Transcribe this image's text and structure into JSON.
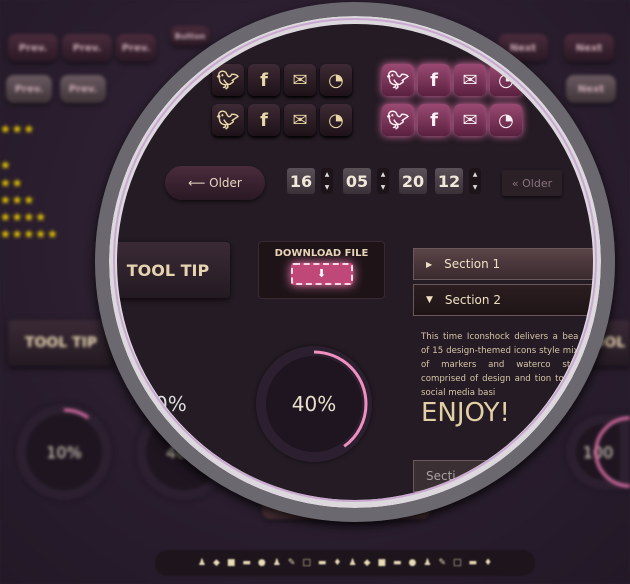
{
  "background": {
    "prev_buttons": [
      "Prev.",
      "Prev.",
      "Prev.",
      "Prev.",
      "Prev.",
      "Prev."
    ],
    "next_buttons": [
      "Next",
      "Next",
      "Next"
    ],
    "button_label": "Button",
    "ratings": [
      3,
      1,
      2,
      3,
      4,
      5
    ],
    "tooltip_left": "TOOL TIP",
    "tooltip_right": "TOOL",
    "progress_rings": [
      {
        "label": "10%",
        "value": 10
      },
      {
        "label": "40%",
        "value": 40
      },
      {
        "label": "100",
        "value": 100
      }
    ],
    "older_faded": "« Older",
    "section_bottom": "Section 3"
  },
  "lens": {
    "social_icons": [
      "twitter-icon",
      "facebook-icon",
      "mail-icon",
      "rss-icon"
    ],
    "older_button": "⟵ Older",
    "counters": [
      "16",
      "05",
      "20",
      "12"
    ],
    "tooltip": "TOOL TIP",
    "download_label": "DOWNLOAD FILE",
    "progress": {
      "label": "40%",
      "value": 40
    },
    "progress_partial": "0%",
    "accordion": [
      {
        "label": "Section 1",
        "expanded": false
      },
      {
        "label": "Section 2",
        "expanded": true
      },
      {
        "label": "Secti",
        "expanded": false
      }
    ],
    "paragraph": "This time Iconshock delivers a bea set of 15 design-themed icons style mixture of markers and waterco strokes, comprised of design and tion tools and social media basi",
    "enjoy": "ENJOY!"
  },
  "colors": {
    "accent": "#e070a8",
    "text": "#e6d4b0",
    "background": "#2b2030"
  }
}
